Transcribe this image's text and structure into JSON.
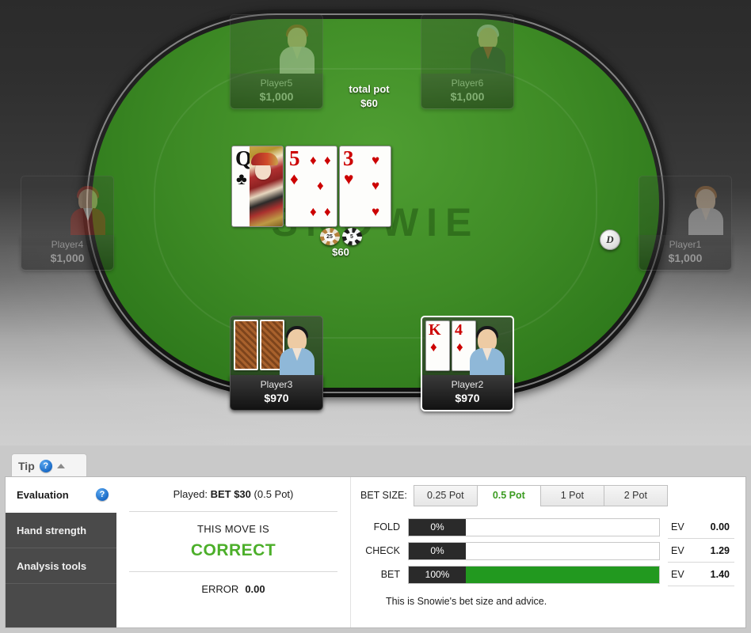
{
  "table": {
    "watermark": "SNOWIE",
    "total_pot_label": "total pot",
    "total_pot_value": "$60",
    "pot_chips_amount": "$60",
    "dealer_button": "D",
    "chips": [
      {
        "denom": "25",
        "style": "brown"
      },
      {
        "denom": "5",
        "style": "black"
      }
    ],
    "board": [
      {
        "rank": "Q",
        "suit": "♣",
        "color": "black",
        "court": true
      },
      {
        "rank": "5",
        "suit": "♦",
        "color": "red",
        "court": false
      },
      {
        "rank": "3",
        "suit": "♥",
        "color": "red",
        "court": false
      }
    ],
    "seats": [
      {
        "id": "player5",
        "name": "Player5",
        "stack": "$1,000",
        "state": "inactive",
        "cards": []
      },
      {
        "id": "player6",
        "name": "Player6",
        "stack": "$1,000",
        "state": "inactive",
        "cards": []
      },
      {
        "id": "player4",
        "name": "Player4",
        "stack": "$1,000",
        "state": "inactive",
        "cards": []
      },
      {
        "id": "player1",
        "name": "Player1",
        "stack": "$1,000",
        "state": "inactive",
        "cards": []
      },
      {
        "id": "player3",
        "name": "Player3",
        "stack": "$970",
        "state": "normal",
        "cards": [
          {
            "face": "down"
          },
          {
            "face": "down"
          }
        ]
      },
      {
        "id": "player2",
        "name": "Player2",
        "stack": "$970",
        "state": "active",
        "cards": [
          {
            "face": "up",
            "rank": "K",
            "suit": "♦",
            "color": "red"
          },
          {
            "face": "up",
            "rank": "4",
            "suit": "♦",
            "color": "red"
          }
        ]
      }
    ]
  },
  "tip_tab": {
    "label": "Tip",
    "help_icon": "?",
    "collapse_icon": "chevron-up"
  },
  "nav": {
    "items": [
      {
        "label": "Evaluation",
        "active": true,
        "help": "?"
      },
      {
        "label": "Hand strength",
        "active": false
      },
      {
        "label": "Analysis tools",
        "active": false
      }
    ]
  },
  "evaluation": {
    "played_prefix": "Played: ",
    "played_action": "BET $30",
    "played_suffix": " (0.5 Pot)",
    "move_label": "THIS MOVE IS",
    "verdict": "CORRECT",
    "verdict_color": "#4caf2a",
    "error_label": "ERROR",
    "error_value": "0.00"
  },
  "bet_panel": {
    "betsize_label": "BET SIZE:",
    "tabs": [
      {
        "label": "0.25 Pot",
        "selected": false
      },
      {
        "label": "0.5 Pot",
        "selected": true
      },
      {
        "label": "1 Pot",
        "selected": false
      },
      {
        "label": "2 Pot",
        "selected": false
      }
    ],
    "rows": [
      {
        "action": "FOLD",
        "percent": "0%",
        "fill": 0,
        "ev_tag": "EV",
        "ev": "0.00"
      },
      {
        "action": "CHECK",
        "percent": "0%",
        "fill": 0,
        "ev_tag": "EV",
        "ev": "1.29"
      },
      {
        "action": "BET",
        "percent": "100%",
        "fill": 100,
        "ev_tag": "EV",
        "ev": "1.40"
      }
    ],
    "advice": "This is Snowie's bet size and advice."
  }
}
